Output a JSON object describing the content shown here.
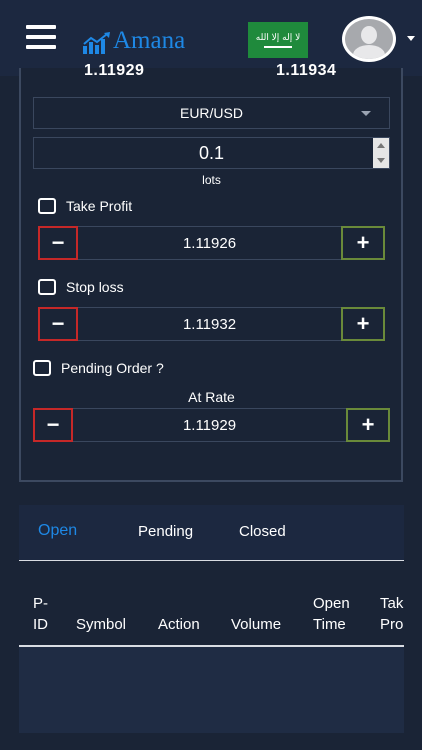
{
  "header": {
    "logo_text": "Amana",
    "flag_script": "لا إله إلا الله"
  },
  "rates": {
    "bid": "1.11929",
    "ask": "1.11934"
  },
  "form": {
    "symbol": "EUR/USD",
    "lots_value": "0.1",
    "lots_label": "lots",
    "take_profit_label": "Take Profit",
    "take_profit_value": "1.11926",
    "stop_loss_label": "Stop loss",
    "stop_loss_value": "1.11932",
    "pending_label": "Pending Order ?",
    "at_rate_label": "At Rate",
    "at_rate_value": "1.11929",
    "minus": "−",
    "plus": "+"
  },
  "tabs": [
    {
      "label": "Open",
      "active": true
    },
    {
      "label": "Pending",
      "active": false
    },
    {
      "label": "Closed",
      "active": false
    }
  ],
  "table": {
    "columns": [
      [
        "P-",
        "ID"
      ],
      [
        "",
        "Symbol"
      ],
      [
        "",
        "Action"
      ],
      [
        "",
        "Volume"
      ],
      [
        "Open",
        "Time"
      ],
      [
        "Tak",
        "Pro"
      ]
    ]
  },
  "colors": {
    "accent": "#1e88e5",
    "minus_border": "#c62828",
    "plus_border": "#6a8a3a",
    "flag_green": "#1f8a3c"
  }
}
